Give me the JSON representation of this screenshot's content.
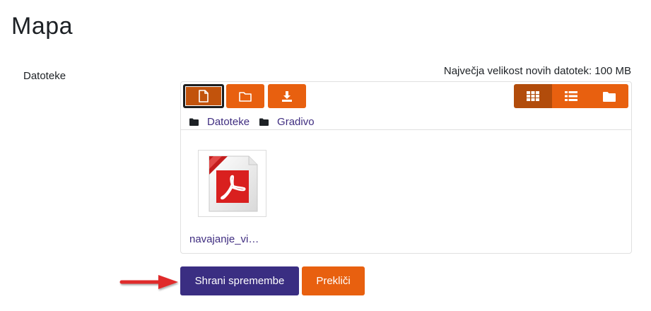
{
  "page": {
    "title": "Mapa"
  },
  "field": {
    "label": "Datoteke"
  },
  "filepicker": {
    "max_size_text": "Največja velikost novih datotek: 100 MB",
    "toolbar": {
      "add_icon": "file-icon",
      "mkdir_icon": "folder-outline-icon",
      "download_icon": "download-icon",
      "views": [
        "grid-icon",
        "list-icon",
        "folder-tree-icon"
      ],
      "active_view": "grid-icon"
    },
    "breadcrumb": [
      "Datoteke",
      "Gradivo"
    ],
    "files": [
      {
        "name": "navajanje_vi…",
        "icon": "pdf-file-icon"
      }
    ]
  },
  "actions": {
    "save_label": "Shrani spremembe",
    "cancel_label": "Prekliči"
  },
  "colors": {
    "accent": "#e8600f",
    "accent_active": "#b24c0b",
    "primary": "#3a2e82",
    "link": "#3f2d80",
    "annotation_arrow": "#e02b2b"
  }
}
